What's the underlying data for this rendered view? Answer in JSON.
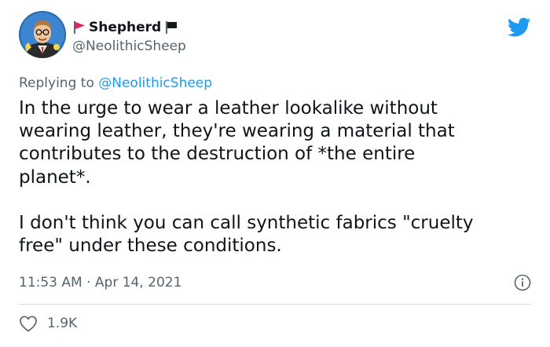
{
  "user": {
    "display_name": "Shepherd",
    "handle": "@NeolithicSheep"
  },
  "icons": {
    "flag_left": "red-flag-icon",
    "flag_right": "black-flag-icon",
    "brand": "twitter-bird-icon",
    "info": "info-icon",
    "like": "heart-icon"
  },
  "reply": {
    "prefix": "Replying to",
    "mention": "@NeolithicSheep"
  },
  "tweet": {
    "text": "In the urge to wear a leather lookalike without\nwearing leather, they're wearing a material that\ncontributes to the destruction of *the entire\nplanet*.\n\nI don't think you can call synthetic fabrics \"cruelty\nfree\" under these conditions.",
    "timestamp": "11:53 AM · Apr 14, 2021",
    "like_count": "1.9K"
  },
  "colors": {
    "text": "#0f1419",
    "secondary": "#536471",
    "accent": "#1d9bf0",
    "divider": "#cfd9de",
    "red_flag": "#e0245e"
  }
}
